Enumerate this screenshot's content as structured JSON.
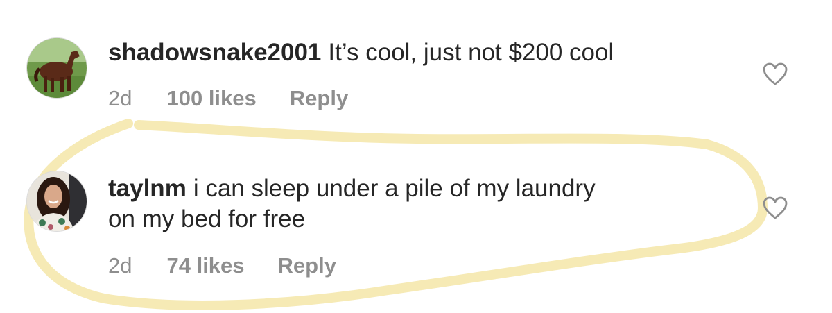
{
  "comments": [
    {
      "username": "shadowsnake2001",
      "text": "It’s cool, just not $200 cool",
      "time": "2d",
      "likes": "100 likes",
      "reply": "Reply",
      "avatar_icon": "horse-avatar",
      "like_icon": "heart-outline-icon"
    },
    {
      "username": "taylnm",
      "text_line1": "i can sleep under a pile of my laundry",
      "text_line2": "on my bed for free",
      "time": "2d",
      "likes": "74 likes",
      "reply": "Reply",
      "avatar_icon": "profile-photo-avatar",
      "like_icon": "heart-outline-icon"
    }
  ],
  "colors": {
    "text": "#262626",
    "meta": "#8e8e8e",
    "highlight": "#f5e6a8",
    "heart_stroke": "#8e8e8e"
  }
}
